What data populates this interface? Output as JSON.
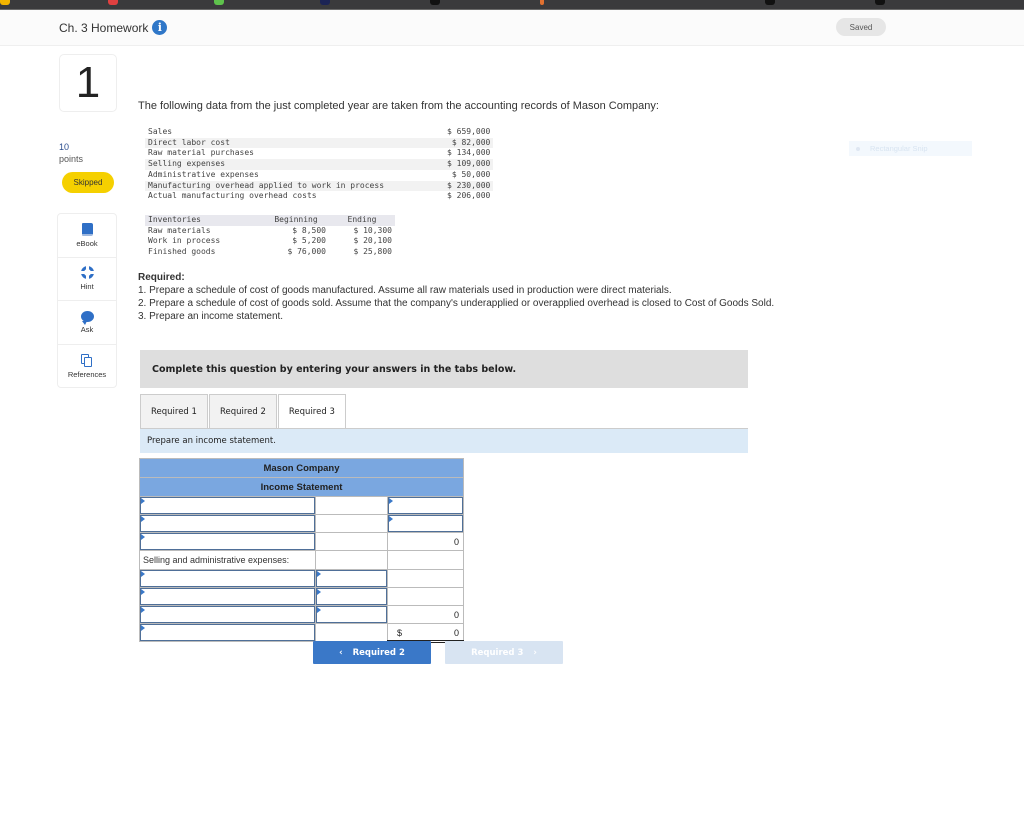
{
  "header": {
    "assignment_title": "Ch. 3 Homework",
    "info_icon": "i",
    "saved_label": "Saved"
  },
  "question": {
    "number": "1",
    "points_value": "10",
    "points_label": "points",
    "status": "Skipped"
  },
  "tools": [
    {
      "label": "eBook",
      "icon": "book-icon"
    },
    {
      "label": "Hint",
      "icon": "lifebuoy-icon"
    },
    {
      "label": "Ask",
      "icon": "speech-bubble-icon"
    },
    {
      "label": "References",
      "icon": "documents-icon"
    }
  ],
  "intro": "The following data from the just completed year are taken from the accounting records of Mason Company:",
  "data_rows": [
    {
      "label": "Sales",
      "amount": "$ 659,000"
    },
    {
      "label": "Direct labor cost",
      "amount": "$ 82,000"
    },
    {
      "label": "Raw material purchases",
      "amount": "$ 134,000"
    },
    {
      "label": "Selling expenses",
      "amount": "$ 109,000"
    },
    {
      "label": "Administrative expenses",
      "amount": "$ 50,000"
    },
    {
      "label": "Manufacturing overhead applied to work in process",
      "amount": "$ 230,000"
    },
    {
      "label": "Actual manufacturing overhead costs",
      "amount": "$ 206,000"
    }
  ],
  "inventories": {
    "headers": [
      "Inventories",
      "Beginning",
      "Ending"
    ],
    "rows": [
      [
        "Raw materials",
        "$ 8,500",
        "$ 10,300"
      ],
      [
        "Work in process",
        "$ 5,200",
        "$ 20,100"
      ],
      [
        "Finished goods",
        "$ 76,000",
        "$ 25,800"
      ]
    ]
  },
  "required": {
    "heading": "Required:",
    "items": [
      "1. Prepare a schedule of cost of goods manufactured. Assume all raw materials used in production were direct materials.",
      "2. Prepare a schedule of cost of goods sold. Assume that the company's underapplied or overapplied overhead is closed to Cost of Goods Sold.",
      "3. Prepare an income statement."
    ]
  },
  "complete_instruction": "Complete this question by entering your answers in the tabs below.",
  "tabs": [
    {
      "label": "Required 1",
      "active": false
    },
    {
      "label": "Required 2",
      "active": false
    },
    {
      "label": "Required 3",
      "active": true
    }
  ],
  "tab_instruction": "Prepare an income statement.",
  "statement": {
    "company": "Mason Company",
    "title": "Income Statement",
    "gross_margin_value": "0",
    "sa_label": "Selling and administrative expenses:",
    "sa_total_value": "0",
    "net_income_currency": "$",
    "net_income_value": "0"
  },
  "nav": {
    "prev_label": "Required 2",
    "prev_icon": "‹",
    "next_label": "Required 3",
    "next_icon": "›"
  },
  "overlay": {
    "snip_label": "Rectangular Snip"
  }
}
